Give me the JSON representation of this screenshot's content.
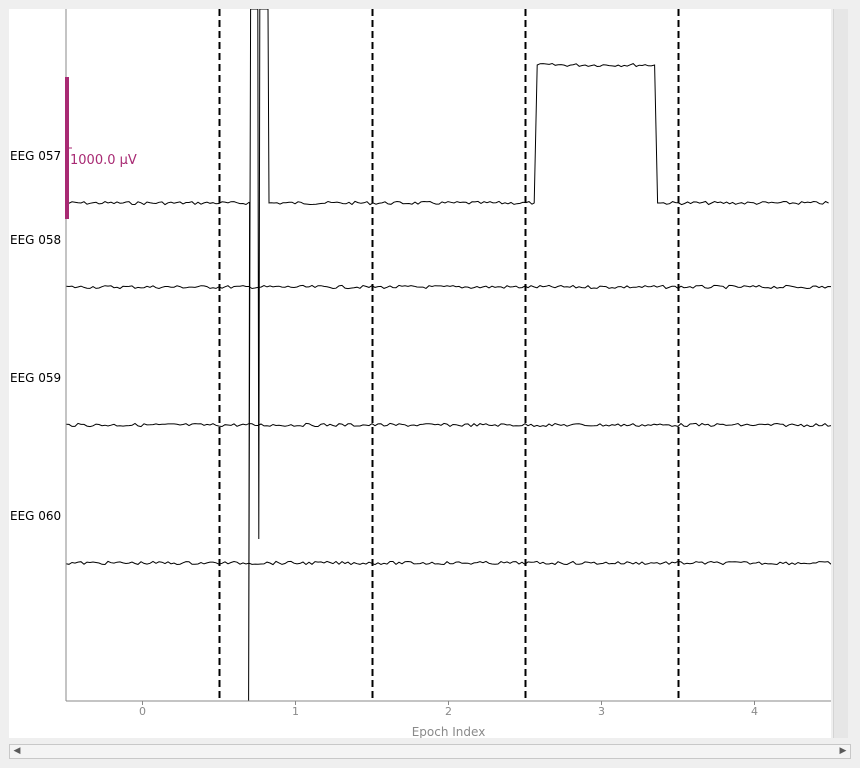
{
  "chart_data": {
    "type": "line",
    "title": "",
    "xlabel": "Epoch Index",
    "ylabel": "",
    "xlim": [
      -0.5,
      4.5
    ],
    "x_ticks": [
      0,
      1,
      2,
      3,
      4
    ],
    "x_tick_labels": [
      "0",
      "1",
      "2",
      "3",
      "4"
    ],
    "epoch_boundaries": [
      0.5,
      1.5,
      2.5,
      3.5
    ],
    "channels": [
      "EEG 057",
      "EEG 058",
      "EEG 059",
      "EEG 060"
    ],
    "scale_bar": {
      "label": "1000.0 µV",
      "channel": "EEG 057",
      "color": "#a82a73"
    },
    "events": {
      "spike_down_x": 0.7,
      "spike_up_x": 0.76,
      "spike_return_x": 0.82,
      "step_x": [
        2.56,
        3.36
      ],
      "step_channel": "EEG 057"
    },
    "grid": false,
    "legend": "none",
    "line_color": "#000000"
  },
  "scrollbars": {
    "left_arrow_icon": "◀",
    "right_arrow_icon": "▶"
  }
}
